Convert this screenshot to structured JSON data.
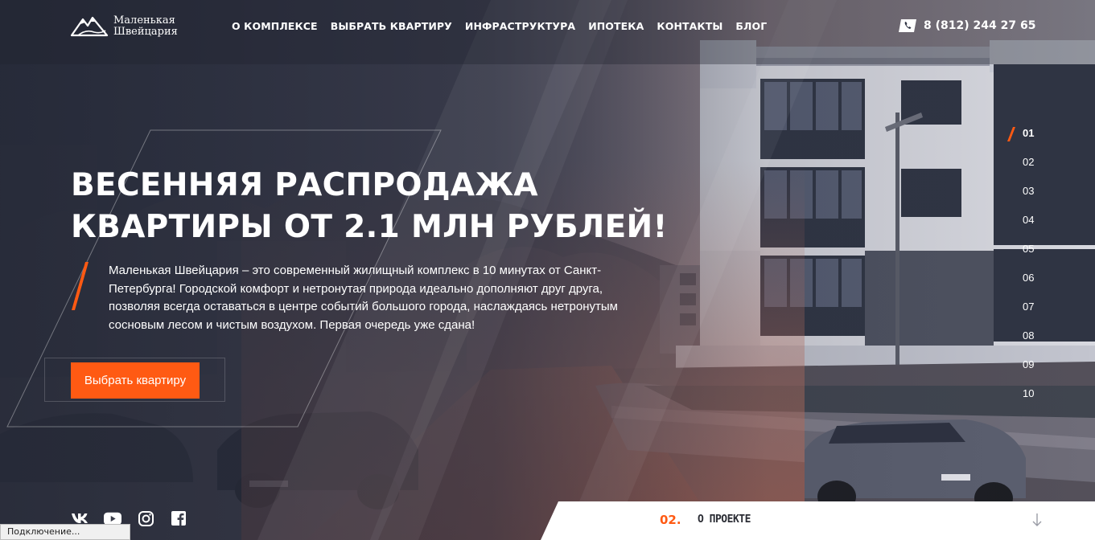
{
  "brand": {
    "name_line1": "Маленькая",
    "name_line2": "Швейцария"
  },
  "nav": {
    "items": [
      {
        "label": "О КОМПЛЕКСЕ"
      },
      {
        "label": "ВЫБРАТЬ КВАРТИРУ"
      },
      {
        "label": "ИНФРАСТРУКТУРА"
      },
      {
        "label": "ИПОТЕКА"
      },
      {
        "label": "КОНТАКТЫ"
      },
      {
        "label": "БЛОГ"
      }
    ]
  },
  "contact": {
    "phone": "8 (812) 244 27 65",
    "icon": "phone-icon"
  },
  "hero": {
    "title_line1": "ВЕСЕННЯЯ РАСПРОДАЖА",
    "title_line2": "КВАРТИРЫ ОТ 2.1 МЛН РУБЛЕЙ!",
    "description": "Маленькая Швейцария – это современный жилищный комплекс в 10 минутах от Санкт-Петербурга! Городской комфорт и нетронутая природа идеально дополняют друг друга, позволяя всегда оставаться в центре событий большого города, наслаждаясь нетронутым сосновым лесом и чистым воздухом. Первая очередь уже сдана!",
    "cta_label": "Выбрать квартиру"
  },
  "slides": {
    "active": "01",
    "items": [
      "01",
      "02",
      "03",
      "04",
      "05",
      "06",
      "07",
      "08",
      "09",
      "10"
    ]
  },
  "social": [
    "vk-icon",
    "youtube-icon",
    "instagram-icon",
    "facebook-icon"
  ],
  "next_section": {
    "number": "02.",
    "label": "О ПРОЕКТЕ"
  },
  "status_bar": {
    "text": "Подключение..."
  },
  "colors": {
    "accent": "#ff5a13",
    "overlay_dark": "#2b3040",
    "white": "#ffffff"
  }
}
